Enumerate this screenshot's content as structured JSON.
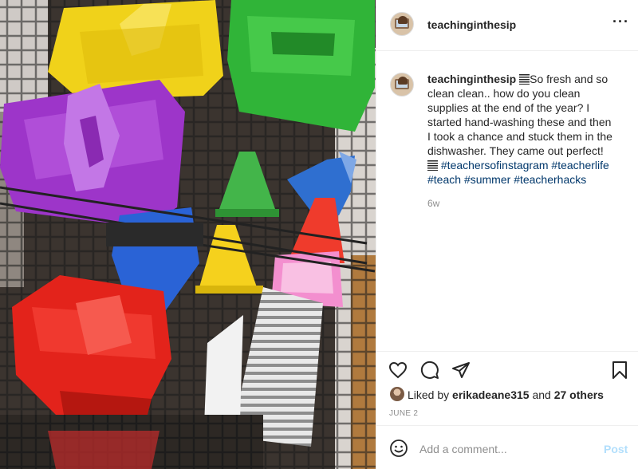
{
  "post": {
    "username": "teachinginthesip",
    "more_icon": "more-horizontal-icon",
    "caption": {
      "username": "teachinginthesip",
      "text_1": "So fresh and so clean clean.. how do you clean supplies at the end of the year? I started hand-washing these and then I took a chance and stuck them in the dishwasher. They came out perfect!",
      "hashtags": [
        "#teachersofinstagram",
        "#teacherlife",
        "#teach",
        "#summer",
        "#teacherhacks"
      ]
    },
    "time_ago": "6w",
    "actions": {
      "like_icon": "heart-icon",
      "comment_icon": "comment-icon",
      "share_icon": "share-icon",
      "save_icon": "bookmark-icon"
    },
    "likes": {
      "prefix": "Liked by",
      "user": "erikadeane315",
      "joiner": "and",
      "others": "27 others"
    },
    "date": "JUNE 2",
    "comment_box": {
      "placeholder": "Add a comment...",
      "post_label": "Post",
      "emoji_icon": "smiley-icon"
    }
  },
  "colors": {
    "hashtag": "#00376b",
    "post_disabled": "#b2dffc",
    "secondary": "#8e8e8e"
  }
}
